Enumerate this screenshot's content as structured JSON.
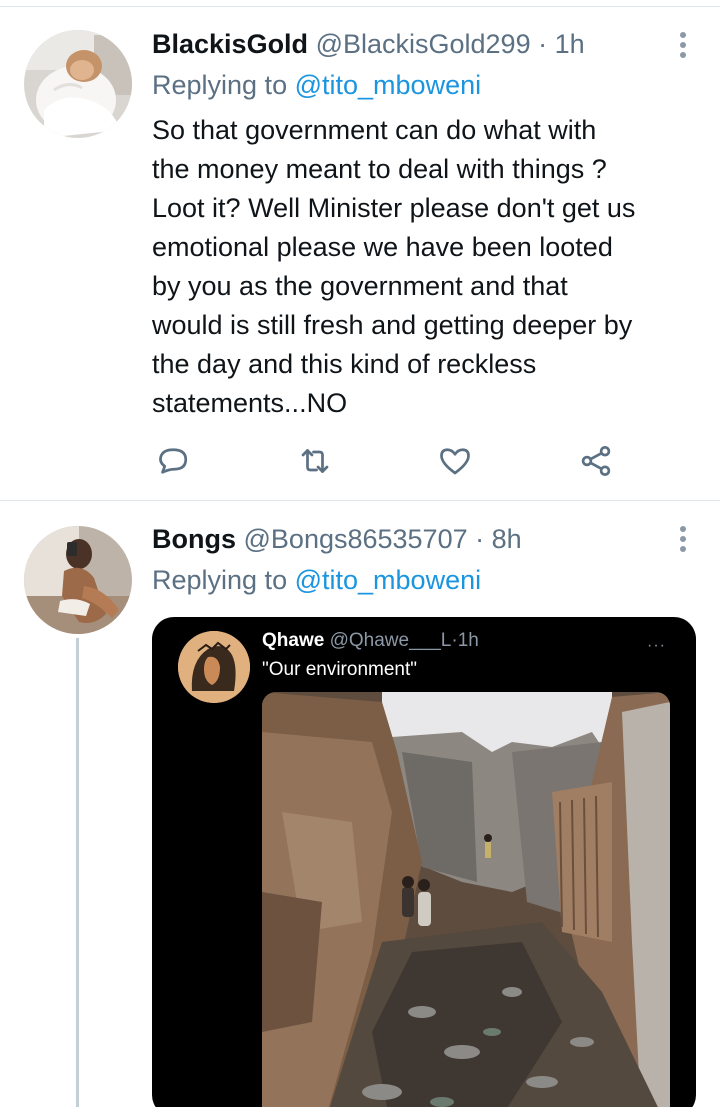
{
  "tweets": [
    {
      "name": "BlackisGold",
      "handle": "@BlackisGold299",
      "separator": "·",
      "time": "1h",
      "replying_prefix": "Replying to",
      "replying_to": "@tito_mboweni",
      "lines": [
        "So that government can do what with",
        "the money meant to deal with things ?",
        "Loot it? Well Minister please don't get us",
        "emotional please we have been looted",
        "by you as the government and that",
        "would is still fresh and getting deeper by",
        "the day and this kind of reckless",
        "statements...NO"
      ],
      "actions": [
        "reply-icon",
        "retweet-icon",
        "like-icon",
        "share-icon"
      ]
    },
    {
      "name": "Bongs",
      "handle": "@Bongs86535707",
      "separator": "·",
      "time": "8h",
      "replying_prefix": "Replying to",
      "replying_to": "@tito_mboweni",
      "embedded": {
        "name": "Qhawe",
        "handle": "@Qhawe___L",
        "separator": "·",
        "time": "1h",
        "more": "···",
        "text": "\"Our environment\""
      }
    }
  ],
  "colors": {
    "text": "#0f1419",
    "secondary": "#5b7083",
    "link": "#1b95e0",
    "divider": "#e1e6ea"
  }
}
